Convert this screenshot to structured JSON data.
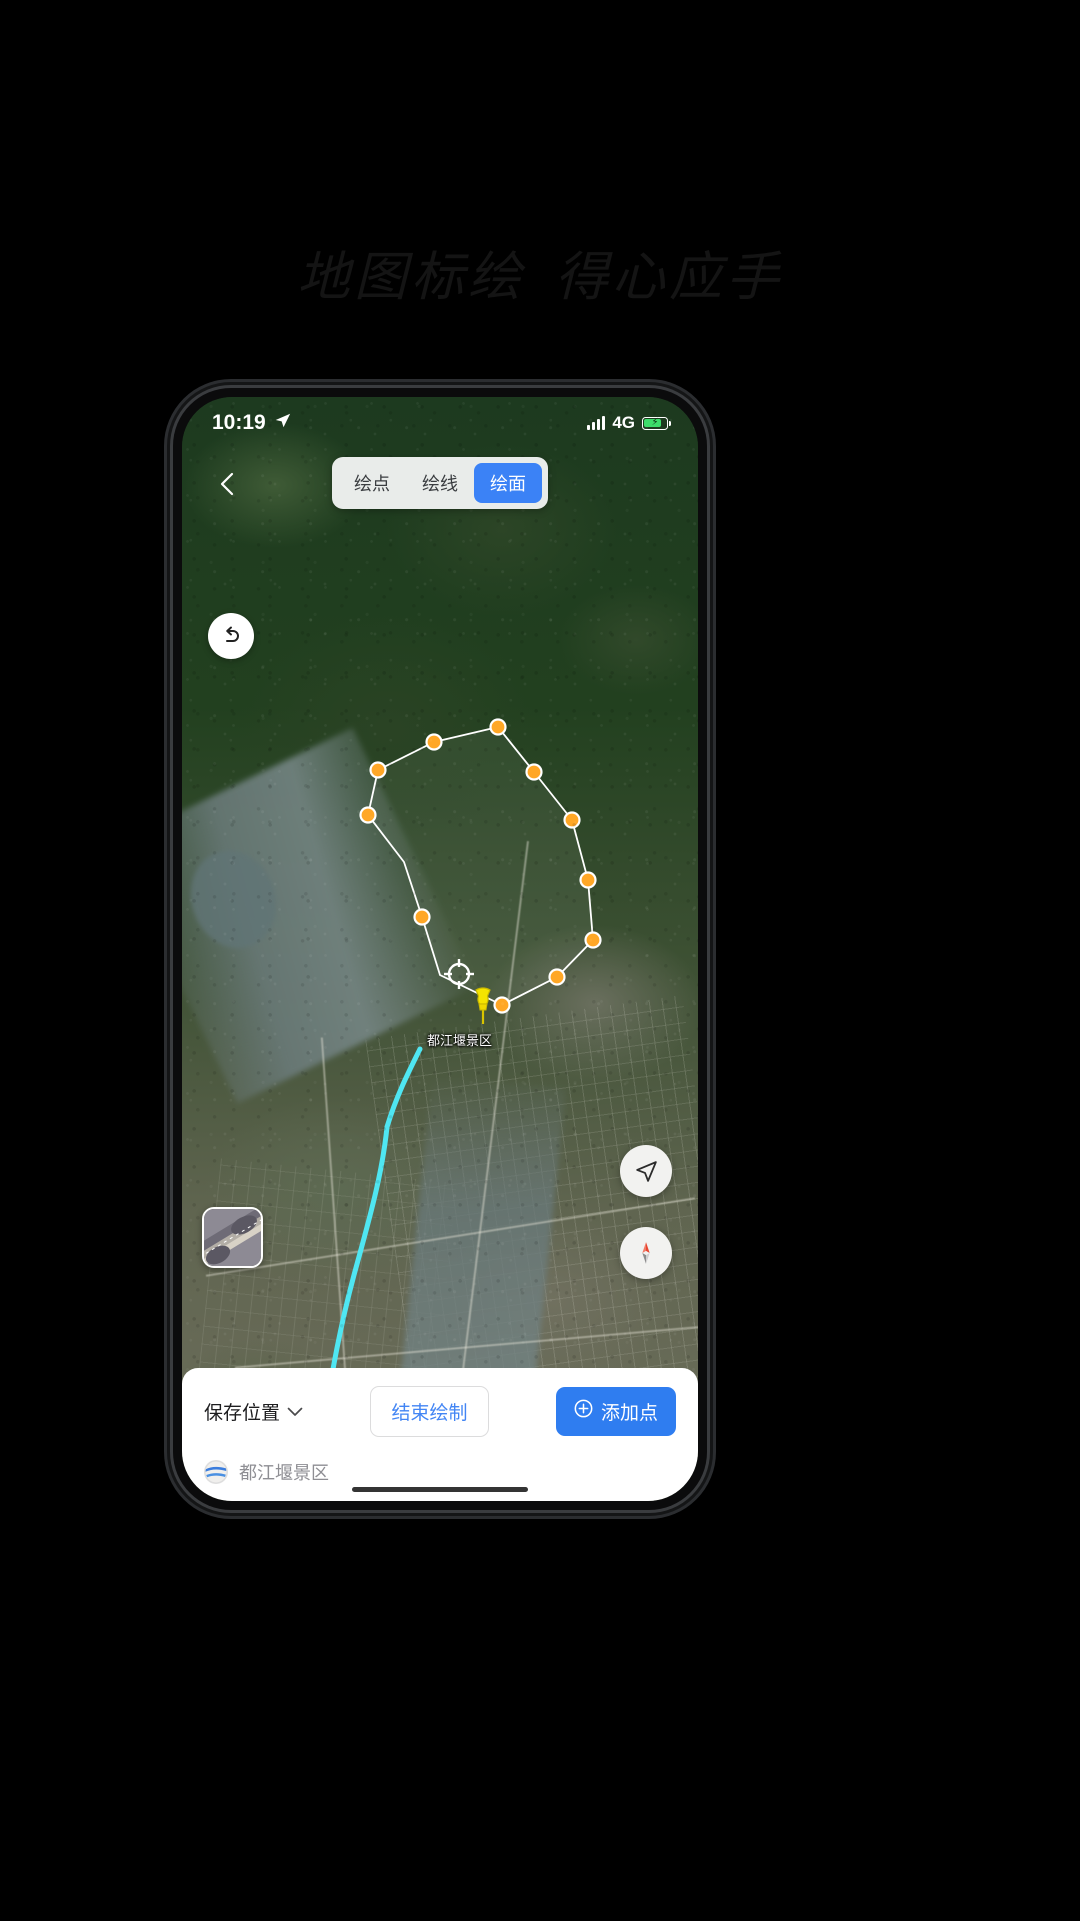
{
  "hero": {
    "line_left": "地图标绘",
    "line_right": "得心应手"
  },
  "status_bar": {
    "time": "10:19",
    "location_icon": "navigation-arrow-icon",
    "signal_icon": "signal-bars-icon",
    "network": "4G",
    "battery_icon": "battery-charging-icon",
    "battery_level_percent": 72
  },
  "top": {
    "back_icon": "chevron-left-icon",
    "tabs": [
      {
        "label": "绘点",
        "active": false
      },
      {
        "label": "绘线",
        "active": false
      },
      {
        "label": "绘面",
        "active": true
      }
    ],
    "undo_icon": "undo-arrow-icon"
  },
  "map": {
    "locate_icon": "navigation-locate-icon",
    "compass_icon": "compass-needle-icon",
    "layer_thumbnail_name": "map-layer-thumbnail",
    "pin_icon": "yellow-pin-marker-icon",
    "pin_label": "都江堰景区",
    "crosshair_icon": "crosshair-center-icon",
    "vertex_count": 11,
    "polygon_color": "#FFA726",
    "polygon_outline_color": "#FFFFFF",
    "river_color": "#4FE6F2"
  },
  "bottom_sheet": {
    "save_position_label": "保存位置",
    "save_position_chevron": "chevron-down-icon",
    "finish_button_label": "结束绘制",
    "add_point_button_label": "添加点",
    "add_point_icon": "plus-circle-icon",
    "footer_icon": "google-earth-icon",
    "footer_label": "都江堰景区"
  },
  "colors": {
    "accent_blue": "#2f7df0",
    "link_blue": "#4285f4",
    "marker_orange": "#FFA726",
    "river_cyan": "#4FE6F2"
  }
}
